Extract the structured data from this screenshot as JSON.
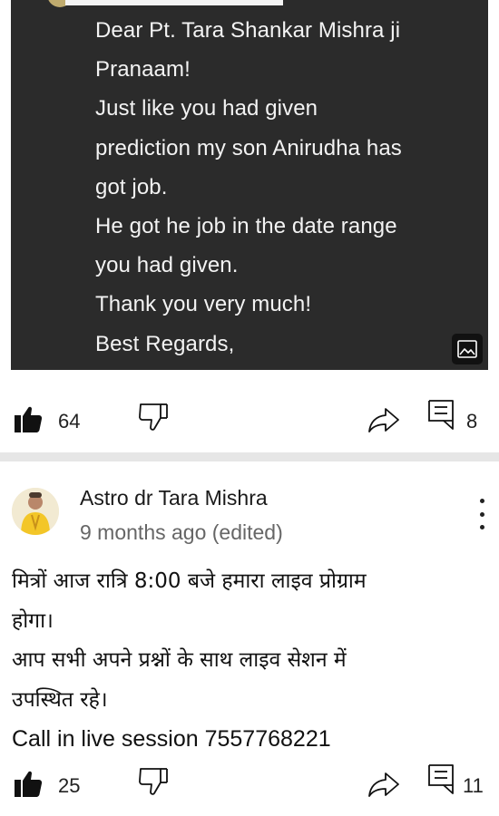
{
  "post1": {
    "image": {
      "lines": [
        "Dear Pt. Tara Shankar Mishra ji",
        "Pranaam!",
        "Just like you had given",
        "prediction my son Anirudha has",
        "got job.",
        "He got he job in the date range",
        "you had given.",
        "Thank you very much!",
        "Best Regards,"
      ],
      "corner_icon": "image-icon"
    },
    "actions": {
      "likes": "64",
      "comments": "8"
    }
  },
  "post2": {
    "channel_name": "Astro dr Tara Mishra",
    "time": "9 months ago (edited)",
    "body": [
      "मित्रों आज रात्रि 8:00 बजे हमारा लाइव प्रोग्राम",
      "होगा।",
      "आप सभी अपने प्रश्नों के साथ लाइव सेशन में",
      "उपस्थित रहे।",
      "Call in live session 7557768221"
    ],
    "actions": {
      "likes": "25",
      "comments": "11"
    }
  },
  "colors": {
    "image_bg": "#2b2b2b",
    "image_text": "#f3f3f3",
    "divider": "#e6e6e6",
    "muted_text": "#666666"
  },
  "icons": [
    "like-icon",
    "dislike-icon",
    "share-icon",
    "comment-icon",
    "more-vert-icon",
    "image-icon"
  ]
}
